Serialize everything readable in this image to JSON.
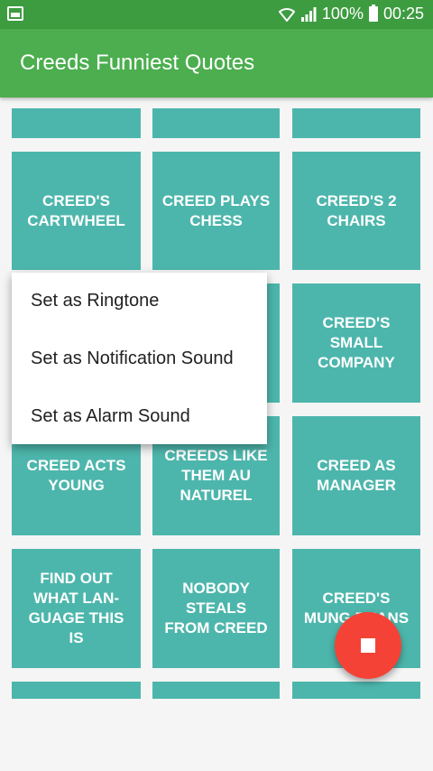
{
  "status_bar": {
    "battery_percent": "100%",
    "time": "00:25",
    "icons": [
      "image-icon",
      "wifi-icon",
      "signal-icon",
      "battery-icon"
    ]
  },
  "app_bar": {
    "title": "Creeds Funniest Quotes"
  },
  "tiles": [
    {
      "label": ""
    },
    {
      "label": ""
    },
    {
      "label": ""
    },
    {
      "label": "CREED'S CARTWHEEL"
    },
    {
      "label": "CREED PLAYS CHESS"
    },
    {
      "label": "CREED'S 2 CHAIRS"
    },
    {
      "label": ""
    },
    {
      "label": ""
    },
    {
      "label": "CREED'S SMALL COMPANY"
    },
    {
      "label": "CREED ACTS YOUNG"
    },
    {
      "label": "CREEDS LIKE THEM AU NATUREL"
    },
    {
      "label": "CREED AS MANAGER"
    },
    {
      "label": "FIND OUT WHAT LAN-GUAGE THIS IS"
    },
    {
      "label": "NOBODY STEALS FROM CREED"
    },
    {
      "label": "CREED'S MUNG BEANS"
    },
    {
      "label": ""
    },
    {
      "label": ""
    },
    {
      "label": ""
    }
  ],
  "popup_menu": {
    "items": [
      "Set as Ringtone",
      "Set as Notification Sound",
      "Set as Alarm Sound"
    ]
  },
  "fab": {
    "icon": "stop-icon"
  },
  "colors": {
    "status_bar": "#3d9c40",
    "app_bar": "#4cae4f",
    "tile": "#4db6ac",
    "fab": "#f44336",
    "background": "#f5f5f5"
  }
}
